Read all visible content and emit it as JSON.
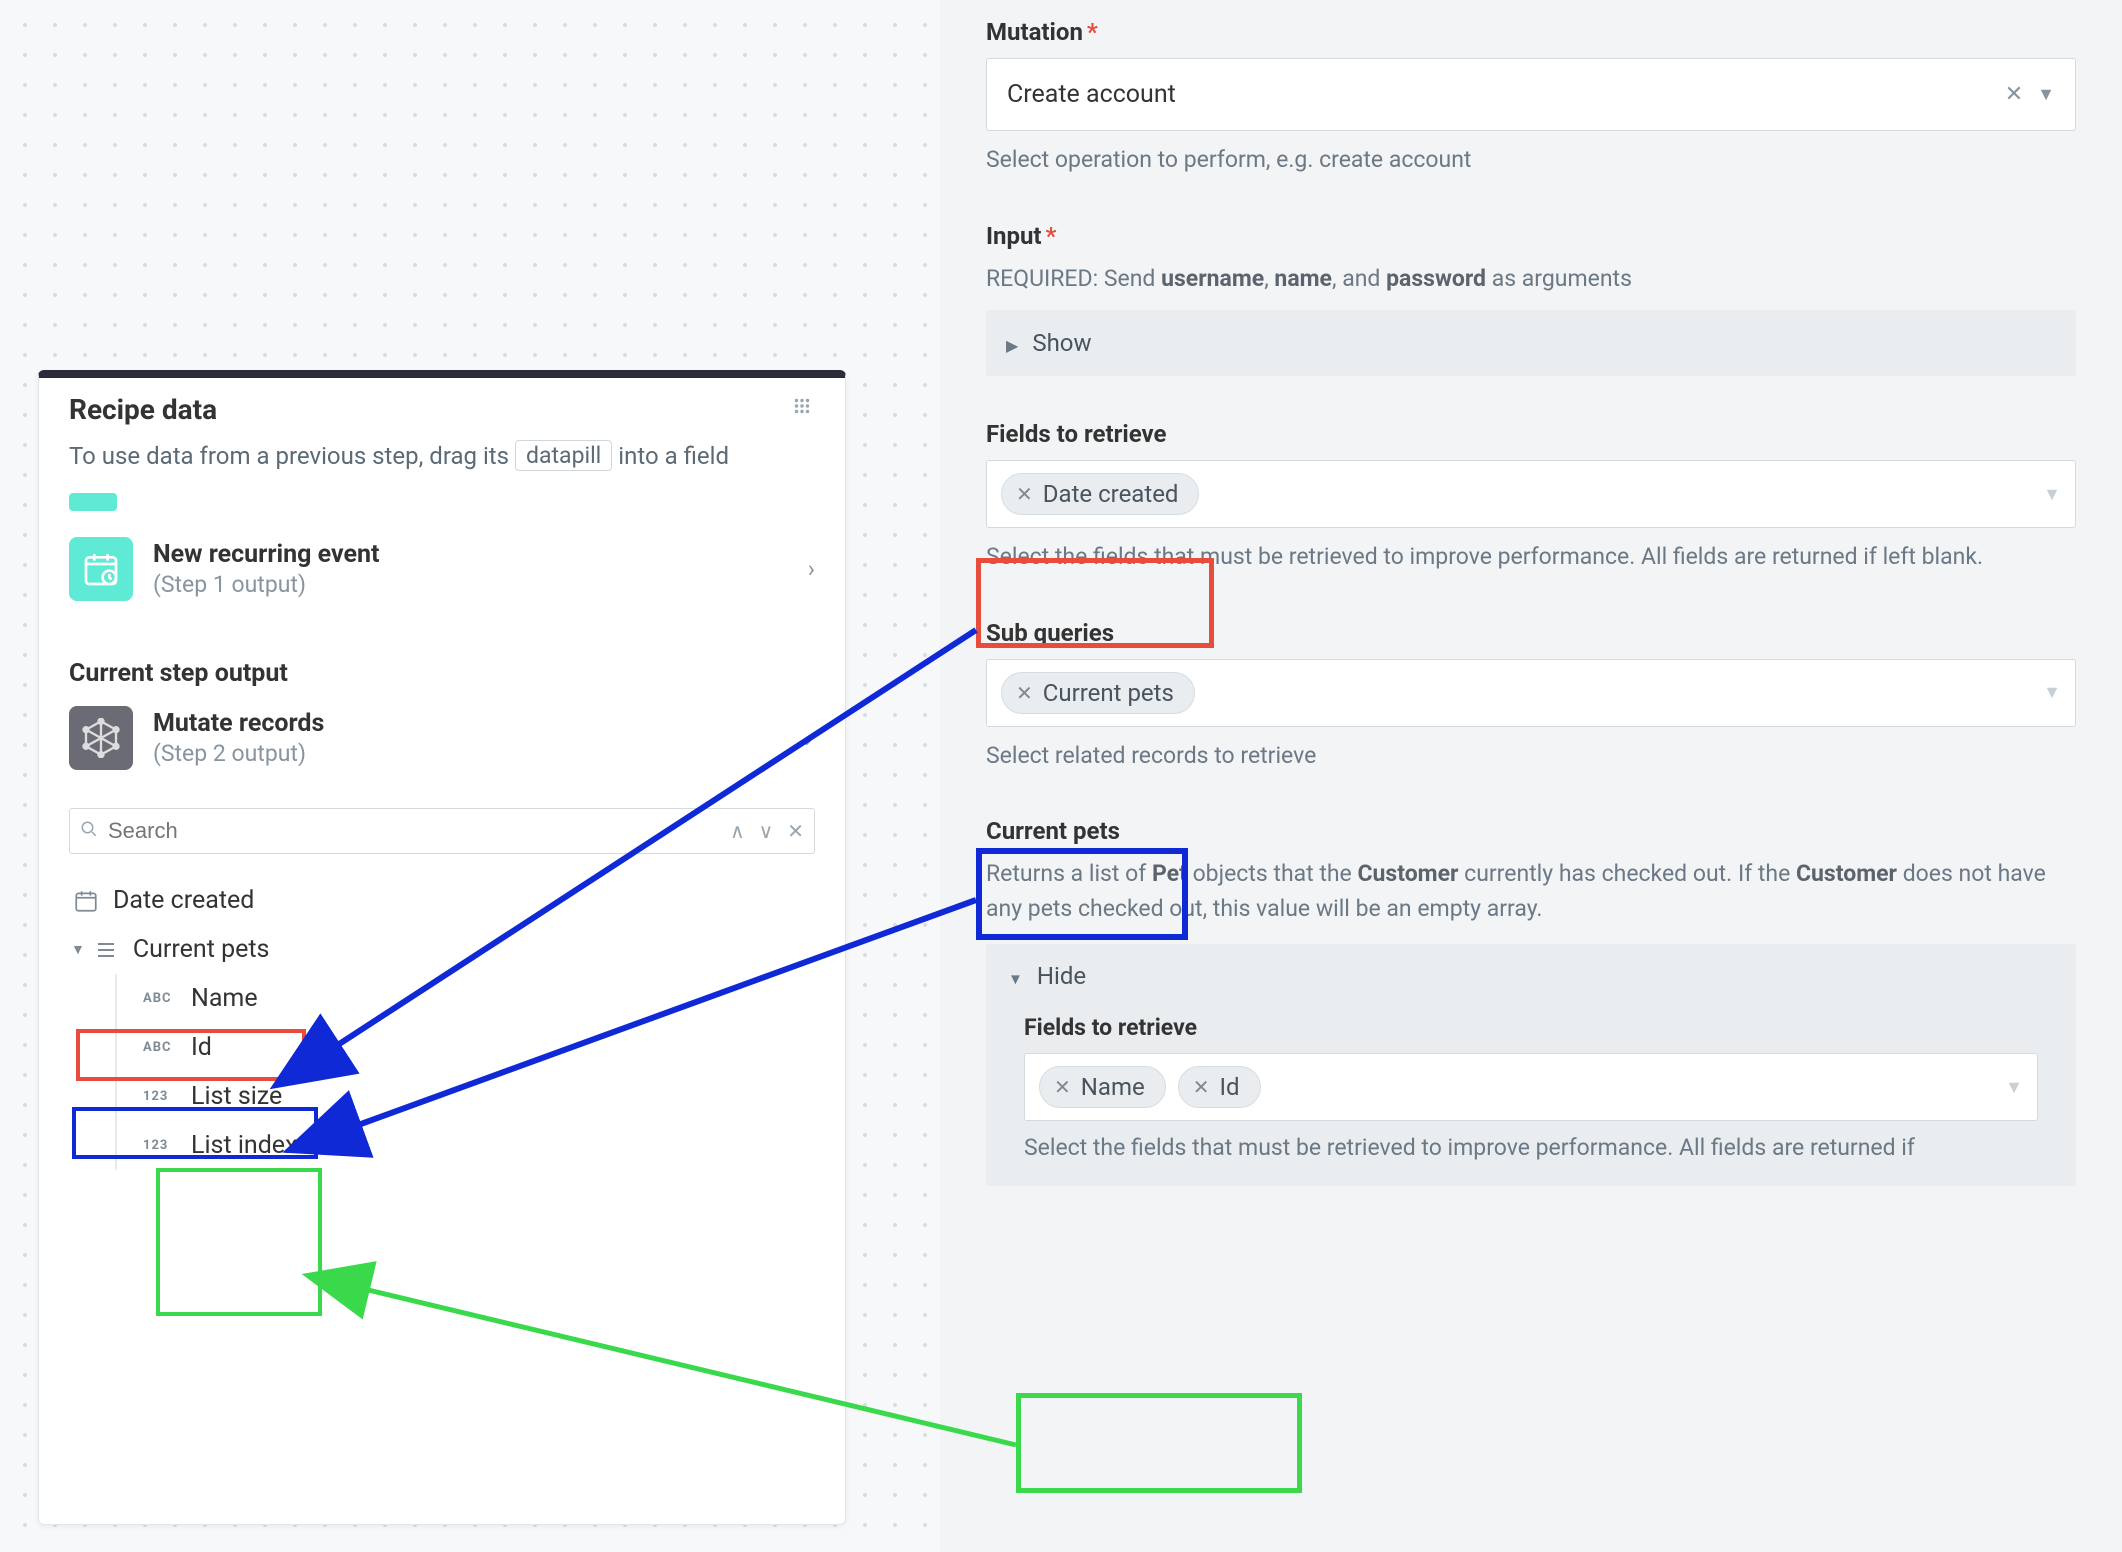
{
  "recipe": {
    "title": "Recipe data",
    "subtitle_pre": "To use data from a previous step, drag its",
    "subtitle_tag": "datapill",
    "subtitle_post": "into a field",
    "step1": {
      "title": "New recurring event",
      "sub": "(Step 1 output)"
    },
    "current_step_label": "Current step output",
    "step2": {
      "title": "Mutate records",
      "sub": "(Step 2 output)"
    },
    "search_placeholder": "Search",
    "tree": {
      "date_created": "Date created",
      "current_pets": "Current pets",
      "name": "Name",
      "id": "Id",
      "list_size": "List size",
      "list_index": "List index",
      "abc": "ABC",
      "num": "123"
    }
  },
  "config": {
    "mutation_label": "Mutation",
    "mutation_value": "Create account",
    "mutation_helper": "Select operation to perform, e.g. create account",
    "input_label": "Input",
    "input_helper_pre": "REQUIRED: Send ",
    "input_helper_b1": "username",
    "input_helper_mid1": ", ",
    "input_helper_b2": "name",
    "input_helper_mid2": ", and ",
    "input_helper_b3": "password",
    "input_helper_post": " as arguments",
    "show": "Show",
    "hide": "Hide",
    "fields_label": "Fields to retrieve",
    "fields_pill1": "Date created",
    "fields_helper": "Select the fields that must be retrieved to improve performance. All fields are returned if left blank.",
    "subq_label": "Sub queries",
    "subq_pill1": "Current pets",
    "subq_helper": "Select related records to retrieve",
    "cp_label": "Current pets",
    "cp_helper_pre": "Returns a list of ",
    "cp_helper_b1": "Pet",
    "cp_helper_mid1": " objects that the ",
    "cp_helper_b2": "Customer",
    "cp_helper_mid2": " currently has checked out. If the ",
    "cp_helper_b3": "Customer",
    "cp_helper_post": " does not have any pets checked out, this value will be an empty array.",
    "inner_fields_label": "Fields to retrieve",
    "inner_pill1": "Name",
    "inner_pill2": "Id",
    "inner_helper": "Select the fields that must be retrieved to improve performance. All fields are returned if"
  }
}
